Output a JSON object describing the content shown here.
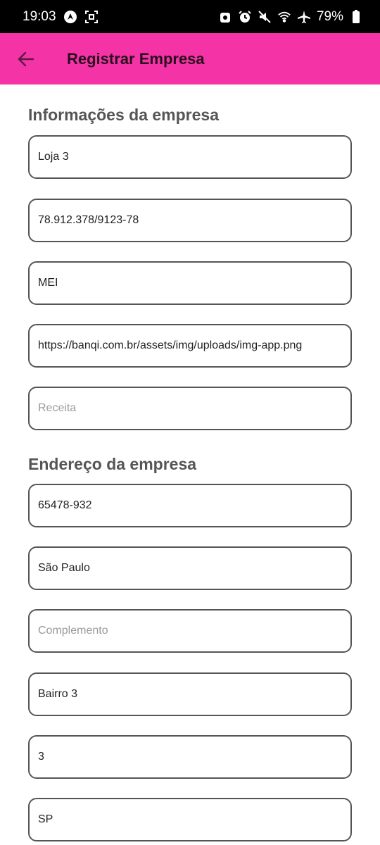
{
  "status_bar": {
    "time": "19:03",
    "battery": "79%"
  },
  "app_bar": {
    "title": "Registrar Empresa",
    "back_icon": "arrow-left-icon"
  },
  "colors": {
    "accent": "#f434a6",
    "border": "#555555",
    "section_title": "#555555"
  },
  "company_info": {
    "title": "Informações da empresa",
    "fields": [
      {
        "value": "Loja 3",
        "placeholder": ""
      },
      {
        "value": "78.912.378/9123-78",
        "placeholder": ""
      },
      {
        "value": "MEI",
        "placeholder": ""
      },
      {
        "value": "https://banqi.com.br/assets/img/uploads/img-app.png",
        "placeholder": ""
      },
      {
        "value": "",
        "placeholder": "Receita"
      }
    ]
  },
  "company_address": {
    "title": "Endereço da empresa",
    "fields": [
      {
        "value": "65478-932",
        "placeholder": ""
      },
      {
        "value": "São Paulo",
        "placeholder": ""
      },
      {
        "value": "",
        "placeholder": "Complemento"
      },
      {
        "value": "Bairro 3",
        "placeholder": ""
      },
      {
        "value": "3",
        "placeholder": ""
      },
      {
        "value": "SP",
        "placeholder": ""
      }
    ]
  }
}
